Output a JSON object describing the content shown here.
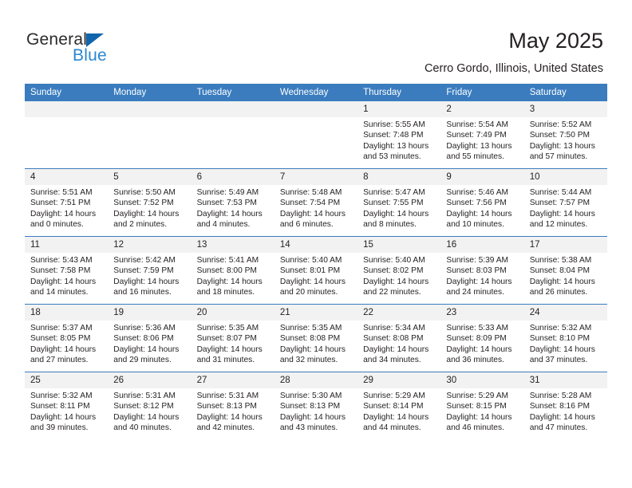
{
  "brand": {
    "name_part1": "General",
    "name_part2": "Blue",
    "triangle_color": "#1065ab",
    "blue_color": "#2a87d0"
  },
  "header": {
    "title": "May 2025",
    "location": "Cerro Gordo, Illinois, United States"
  },
  "theme": {
    "header_blue": "#3a7cbe",
    "daynum_band": "#f2f2f2",
    "text": "#231f20"
  },
  "weekday_headers": [
    "Sunday",
    "Monday",
    "Tuesday",
    "Wednesday",
    "Thursday",
    "Friday",
    "Saturday"
  ],
  "weeks": [
    [
      {
        "day": "",
        "sunrise": "",
        "sunset": "",
        "daylight_line1": "",
        "daylight_line2": ""
      },
      {
        "day": "",
        "sunrise": "",
        "sunset": "",
        "daylight_line1": "",
        "daylight_line2": ""
      },
      {
        "day": "",
        "sunrise": "",
        "sunset": "",
        "daylight_line1": "",
        "daylight_line2": ""
      },
      {
        "day": "",
        "sunrise": "",
        "sunset": "",
        "daylight_line1": "",
        "daylight_line2": ""
      },
      {
        "day": "1",
        "sunrise": "Sunrise: 5:55 AM",
        "sunset": "Sunset: 7:48 PM",
        "daylight_line1": "Daylight: 13 hours",
        "daylight_line2": "and 53 minutes."
      },
      {
        "day": "2",
        "sunrise": "Sunrise: 5:54 AM",
        "sunset": "Sunset: 7:49 PM",
        "daylight_line1": "Daylight: 13 hours",
        "daylight_line2": "and 55 minutes."
      },
      {
        "day": "3",
        "sunrise": "Sunrise: 5:52 AM",
        "sunset": "Sunset: 7:50 PM",
        "daylight_line1": "Daylight: 13 hours",
        "daylight_line2": "and 57 minutes."
      }
    ],
    [
      {
        "day": "4",
        "sunrise": "Sunrise: 5:51 AM",
        "sunset": "Sunset: 7:51 PM",
        "daylight_line1": "Daylight: 14 hours",
        "daylight_line2": "and 0 minutes."
      },
      {
        "day": "5",
        "sunrise": "Sunrise: 5:50 AM",
        "sunset": "Sunset: 7:52 PM",
        "daylight_line1": "Daylight: 14 hours",
        "daylight_line2": "and 2 minutes."
      },
      {
        "day": "6",
        "sunrise": "Sunrise: 5:49 AM",
        "sunset": "Sunset: 7:53 PM",
        "daylight_line1": "Daylight: 14 hours",
        "daylight_line2": "and 4 minutes."
      },
      {
        "day": "7",
        "sunrise": "Sunrise: 5:48 AM",
        "sunset": "Sunset: 7:54 PM",
        "daylight_line1": "Daylight: 14 hours",
        "daylight_line2": "and 6 minutes."
      },
      {
        "day": "8",
        "sunrise": "Sunrise: 5:47 AM",
        "sunset": "Sunset: 7:55 PM",
        "daylight_line1": "Daylight: 14 hours",
        "daylight_line2": "and 8 minutes."
      },
      {
        "day": "9",
        "sunrise": "Sunrise: 5:46 AM",
        "sunset": "Sunset: 7:56 PM",
        "daylight_line1": "Daylight: 14 hours",
        "daylight_line2": "and 10 minutes."
      },
      {
        "day": "10",
        "sunrise": "Sunrise: 5:44 AM",
        "sunset": "Sunset: 7:57 PM",
        "daylight_line1": "Daylight: 14 hours",
        "daylight_line2": "and 12 minutes."
      }
    ],
    [
      {
        "day": "11",
        "sunrise": "Sunrise: 5:43 AM",
        "sunset": "Sunset: 7:58 PM",
        "daylight_line1": "Daylight: 14 hours",
        "daylight_line2": "and 14 minutes."
      },
      {
        "day": "12",
        "sunrise": "Sunrise: 5:42 AM",
        "sunset": "Sunset: 7:59 PM",
        "daylight_line1": "Daylight: 14 hours",
        "daylight_line2": "and 16 minutes."
      },
      {
        "day": "13",
        "sunrise": "Sunrise: 5:41 AM",
        "sunset": "Sunset: 8:00 PM",
        "daylight_line1": "Daylight: 14 hours",
        "daylight_line2": "and 18 minutes."
      },
      {
        "day": "14",
        "sunrise": "Sunrise: 5:40 AM",
        "sunset": "Sunset: 8:01 PM",
        "daylight_line1": "Daylight: 14 hours",
        "daylight_line2": "and 20 minutes."
      },
      {
        "day": "15",
        "sunrise": "Sunrise: 5:40 AM",
        "sunset": "Sunset: 8:02 PM",
        "daylight_line1": "Daylight: 14 hours",
        "daylight_line2": "and 22 minutes."
      },
      {
        "day": "16",
        "sunrise": "Sunrise: 5:39 AM",
        "sunset": "Sunset: 8:03 PM",
        "daylight_line1": "Daylight: 14 hours",
        "daylight_line2": "and 24 minutes."
      },
      {
        "day": "17",
        "sunrise": "Sunrise: 5:38 AM",
        "sunset": "Sunset: 8:04 PM",
        "daylight_line1": "Daylight: 14 hours",
        "daylight_line2": "and 26 minutes."
      }
    ],
    [
      {
        "day": "18",
        "sunrise": "Sunrise: 5:37 AM",
        "sunset": "Sunset: 8:05 PM",
        "daylight_line1": "Daylight: 14 hours",
        "daylight_line2": "and 27 minutes."
      },
      {
        "day": "19",
        "sunrise": "Sunrise: 5:36 AM",
        "sunset": "Sunset: 8:06 PM",
        "daylight_line1": "Daylight: 14 hours",
        "daylight_line2": "and 29 minutes."
      },
      {
        "day": "20",
        "sunrise": "Sunrise: 5:35 AM",
        "sunset": "Sunset: 8:07 PM",
        "daylight_line1": "Daylight: 14 hours",
        "daylight_line2": "and 31 minutes."
      },
      {
        "day": "21",
        "sunrise": "Sunrise: 5:35 AM",
        "sunset": "Sunset: 8:08 PM",
        "daylight_line1": "Daylight: 14 hours",
        "daylight_line2": "and 32 minutes."
      },
      {
        "day": "22",
        "sunrise": "Sunrise: 5:34 AM",
        "sunset": "Sunset: 8:08 PM",
        "daylight_line1": "Daylight: 14 hours",
        "daylight_line2": "and 34 minutes."
      },
      {
        "day": "23",
        "sunrise": "Sunrise: 5:33 AM",
        "sunset": "Sunset: 8:09 PM",
        "daylight_line1": "Daylight: 14 hours",
        "daylight_line2": "and 36 minutes."
      },
      {
        "day": "24",
        "sunrise": "Sunrise: 5:32 AM",
        "sunset": "Sunset: 8:10 PM",
        "daylight_line1": "Daylight: 14 hours",
        "daylight_line2": "and 37 minutes."
      }
    ],
    [
      {
        "day": "25",
        "sunrise": "Sunrise: 5:32 AM",
        "sunset": "Sunset: 8:11 PM",
        "daylight_line1": "Daylight: 14 hours",
        "daylight_line2": "and 39 minutes."
      },
      {
        "day": "26",
        "sunrise": "Sunrise: 5:31 AM",
        "sunset": "Sunset: 8:12 PM",
        "daylight_line1": "Daylight: 14 hours",
        "daylight_line2": "and 40 minutes."
      },
      {
        "day": "27",
        "sunrise": "Sunrise: 5:31 AM",
        "sunset": "Sunset: 8:13 PM",
        "daylight_line1": "Daylight: 14 hours",
        "daylight_line2": "and 42 minutes."
      },
      {
        "day": "28",
        "sunrise": "Sunrise: 5:30 AM",
        "sunset": "Sunset: 8:13 PM",
        "daylight_line1": "Daylight: 14 hours",
        "daylight_line2": "and 43 minutes."
      },
      {
        "day": "29",
        "sunrise": "Sunrise: 5:29 AM",
        "sunset": "Sunset: 8:14 PM",
        "daylight_line1": "Daylight: 14 hours",
        "daylight_line2": "and 44 minutes."
      },
      {
        "day": "30",
        "sunrise": "Sunrise: 5:29 AM",
        "sunset": "Sunset: 8:15 PM",
        "daylight_line1": "Daylight: 14 hours",
        "daylight_line2": "and 46 minutes."
      },
      {
        "day": "31",
        "sunrise": "Sunrise: 5:28 AM",
        "sunset": "Sunset: 8:16 PM",
        "daylight_line1": "Daylight: 14 hours",
        "daylight_line2": "and 47 minutes."
      }
    ]
  ]
}
